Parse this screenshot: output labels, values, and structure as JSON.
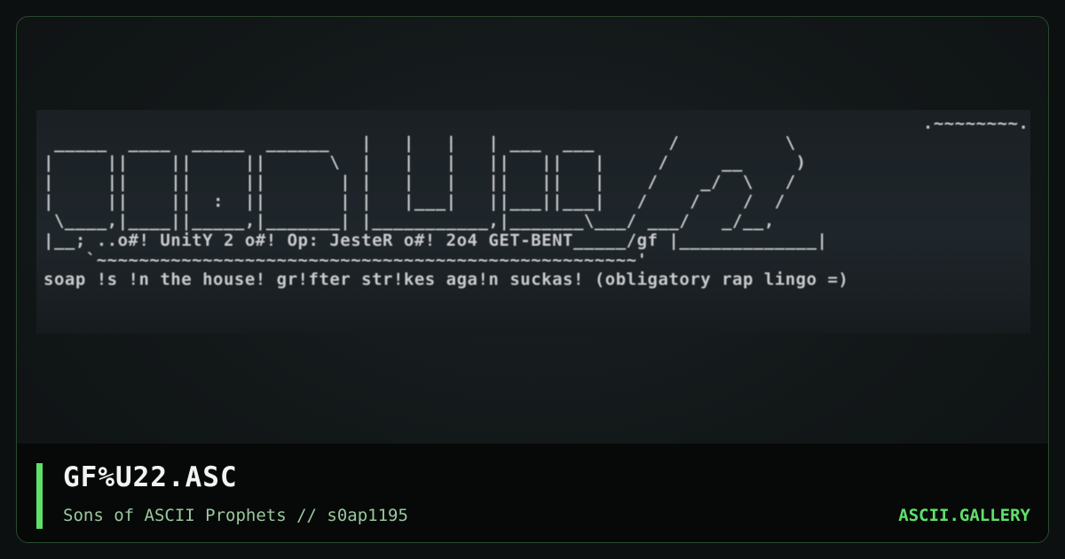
{
  "art": {
    "lines": [
      "                                                                                   .~~~~~~~~.",
      " _____  ____  _____  ______   |   |   |   | ___  ___       /          \\",
      "|     ||    ||     ||      \\  |   |   |   ||   ||   |     /     __     )",
      "|     ||    ||     ||       | |   |   |   ||   ||   |    /    _/  \\   /",
      "|     ||    ||  :  ||       | |   |___|   ||___||___|   /    /    /  /",
      " \\____,|____||_____,|_______| |___________,|_______\\___/ ___/   _/__,",
      "|__; ..o#! UnitY 2 o#! Op: JesteR o#! 2o4 GET-BENT_____/gf |_____________|",
      "    `~~~~~~~~~~~~~~~~~~~~~~~~~~~~~~~~~~~~~~~~~~~~~~~~~~~'",
      "soap !s !n the house! gr!fter str!kes aga!n suckas! (obligatory rap lingo =)"
    ]
  },
  "footer": {
    "title": "GF%U22.ASC",
    "subtitle": "Sons of ASCII Prophets // s0ap1195",
    "brand": "ASCII.GALLERY"
  },
  "colors": {
    "accent": "#5fe06a",
    "subtitle": "#9bc89f",
    "title": "#f2f4f2"
  }
}
